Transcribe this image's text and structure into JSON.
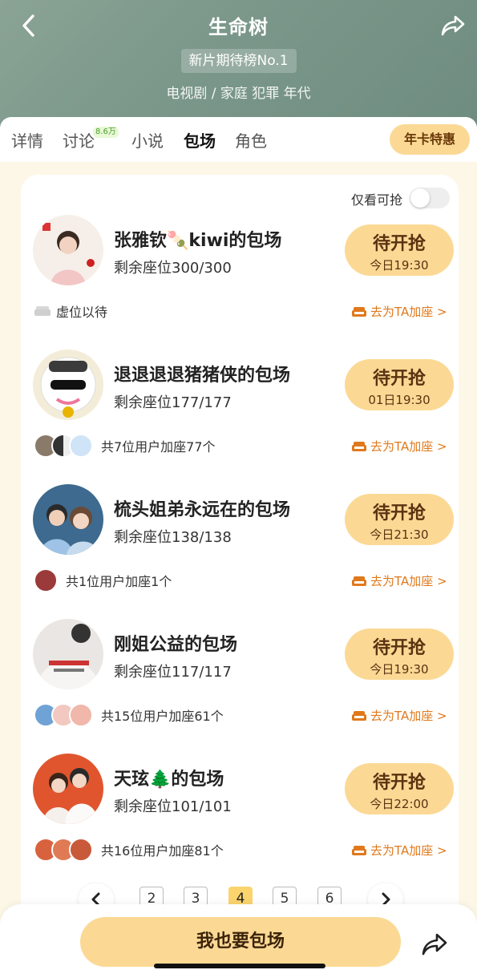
{
  "header": {
    "title": "生命树",
    "rank_badge": "新片期待榜No.1",
    "genres": "电视剧 / 家庭 犯罪 年代"
  },
  "tabs": [
    {
      "label": "详情",
      "active": false
    },
    {
      "label": "讨论",
      "active": false,
      "badge": "8.6万"
    },
    {
      "label": "小说",
      "active": false
    },
    {
      "label": "包场",
      "active": true
    },
    {
      "label": "角色",
      "active": false
    }
  ],
  "yearcard_label": "年卡特惠",
  "filter": {
    "label": "仅看可抢",
    "on": false
  },
  "entries": [
    {
      "name": "张雅钦🍡kiwi的包场",
      "seats": "剩余座位300/300",
      "status": "待开抢",
      "time": "今日19:30",
      "join": "虚位以待",
      "add": "去为TA加座 >"
    },
    {
      "name": "退退退退猪猪侠的包场",
      "seats": "剩余座位177/177",
      "status": "待开抢",
      "time": "01日19:30",
      "join": "共7位用户加座77个",
      "add": "去为TA加座 >"
    },
    {
      "name": "梳头姐弟永远在的包场",
      "seats": "剩余座位138/138",
      "status": "待开抢",
      "time": "今日21:30",
      "join": "共1位用户加座1个",
      "add": "去为TA加座 >"
    },
    {
      "name": "刚姐公益的包场",
      "seats": "剩余座位117/117",
      "status": "待开抢",
      "time": "今日19:30",
      "join": "共15位用户加座61个",
      "add": "去为TA加座 >"
    },
    {
      "name": "天玹🌲的包场",
      "seats": "剩余座位101/101",
      "status": "待开抢",
      "time": "今日22:00",
      "join": "共16位用户加座81个",
      "add": "去为TA加座 >"
    }
  ],
  "pagination": {
    "pages": [
      "2",
      "3",
      "4",
      "5",
      "6"
    ],
    "current": "4"
  },
  "cta_label": "我也要包场",
  "colors": {
    "accent": "#fbd995",
    "link": "#e0791c",
    "header": "#7a978a"
  }
}
